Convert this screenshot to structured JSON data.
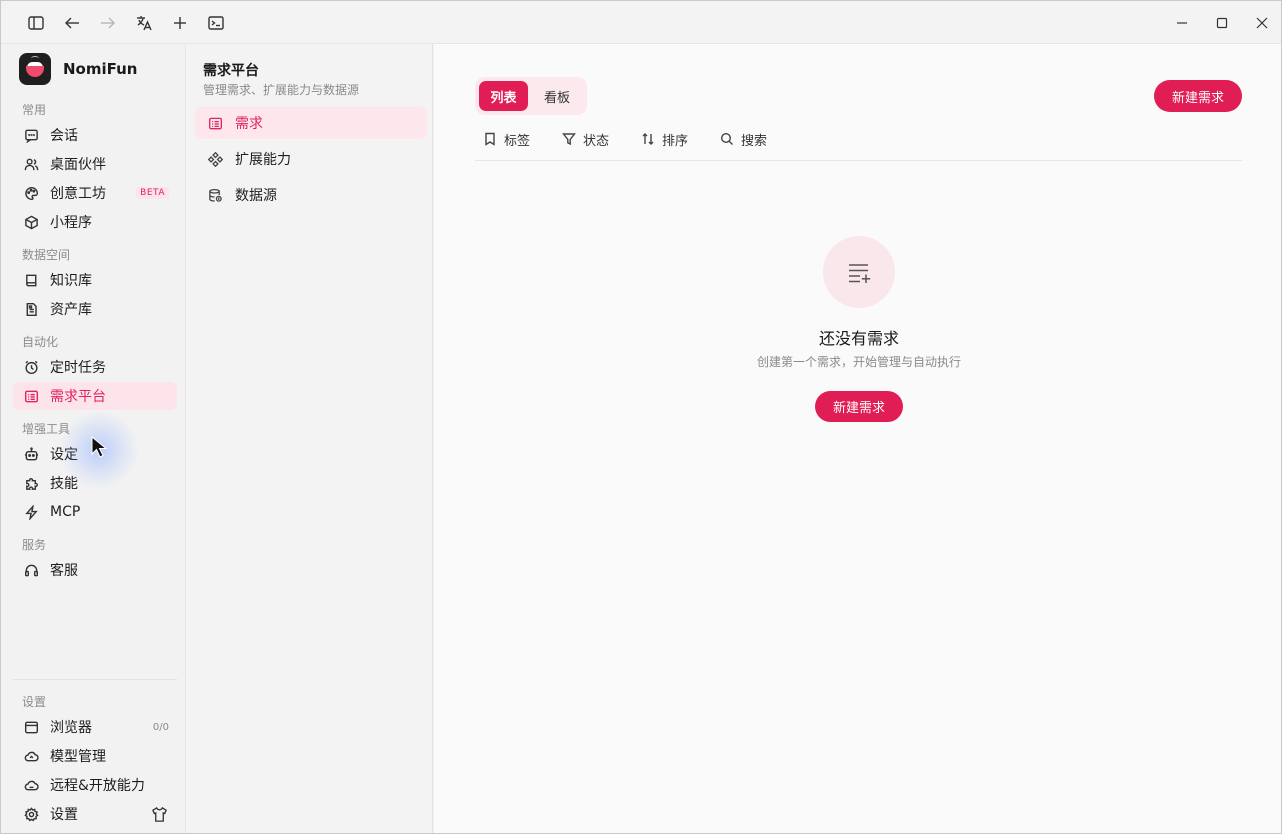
{
  "app": {
    "name": "NomiFun"
  },
  "sidebar": {
    "sections": {
      "common": "常用",
      "data_space": "数据空间",
      "automation": "自动化",
      "enhance": "增强工具",
      "service": "服务",
      "settings": "设置"
    },
    "items": [
      {
        "label": "会话",
        "icon": "chat-icon"
      },
      {
        "label": "桌面伙伴",
        "icon": "users-icon"
      },
      {
        "label": "创意工坊",
        "icon": "palette-icon",
        "badge": "BETA"
      },
      {
        "label": "小程序",
        "icon": "cube-icon"
      },
      {
        "label": "知识库",
        "icon": "book-icon"
      },
      {
        "label": "资产库",
        "icon": "file-icon"
      },
      {
        "label": "定时任务",
        "icon": "clock-icon"
      },
      {
        "label": "需求平台",
        "icon": "list-icon",
        "active": true
      },
      {
        "label": "设定",
        "icon": "robot-icon"
      },
      {
        "label": "技能",
        "icon": "puzzle-icon"
      },
      {
        "label": "MCP",
        "icon": "bolt-icon"
      },
      {
        "label": "客服",
        "icon": "headset-icon"
      }
    ],
    "bottom": [
      {
        "label": "浏览器",
        "icon": "browser-icon",
        "counter": "0/0"
      },
      {
        "label": "模型管理",
        "icon": "cloud-icon"
      },
      {
        "label": "远程&开放能力",
        "icon": "cloud-sync-icon"
      },
      {
        "label": "设置",
        "icon": "gear-icon"
      }
    ]
  },
  "subpanel": {
    "title": "需求平台",
    "subtitle": "管理需求、扩展能力与数据源",
    "items": [
      {
        "label": "需求",
        "icon": "list-icon",
        "active": true
      },
      {
        "label": "扩展能力",
        "icon": "extension-icon"
      },
      {
        "label": "数据源",
        "icon": "database-icon"
      }
    ]
  },
  "main": {
    "view_tabs": {
      "list": "列表",
      "board": "看板",
      "selected": "列表"
    },
    "new_button": "新建需求",
    "toolbar": {
      "tag": "标签",
      "status": "状态",
      "sort": "排序",
      "search": "搜索"
    },
    "empty": {
      "title": "还没有需求",
      "subtitle": "创建第一个需求，开始管理与自动执行",
      "button": "新建需求"
    }
  },
  "colors": {
    "accent": "#e11d55",
    "accent_light": "#fde4ea"
  }
}
